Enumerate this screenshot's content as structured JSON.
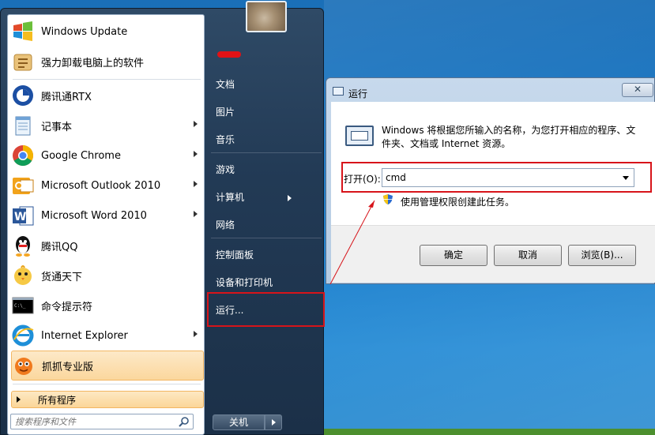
{
  "start_menu": {
    "programs": [
      {
        "label": "Windows Update",
        "icon": "windows-update-icon",
        "has_submenu": false
      },
      {
        "label": "强力卸载电脑上的软件",
        "icon": "uninstall-icon",
        "has_submenu": false
      },
      {
        "label": "腾讯通RTX",
        "icon": "rtx-icon",
        "has_submenu": false
      },
      {
        "label": "记事本",
        "icon": "notepad-icon",
        "has_submenu": true
      },
      {
        "label": "Google Chrome",
        "icon": "chrome-icon",
        "has_submenu": true
      },
      {
        "label": "Microsoft Outlook 2010",
        "icon": "outlook-icon",
        "has_submenu": true
      },
      {
        "label": "Microsoft Word 2010",
        "icon": "word-icon",
        "has_submenu": true
      },
      {
        "label": "腾讯QQ",
        "icon": "qq-icon",
        "has_submenu": false
      },
      {
        "label": "货通天下",
        "icon": "chick-icon",
        "has_submenu": false
      },
      {
        "label": "命令提示符",
        "icon": "cmd-icon",
        "has_submenu": false
      },
      {
        "label": "Internet Explorer",
        "icon": "ie-icon",
        "has_submenu": true
      },
      {
        "label": "抓抓专业版",
        "icon": "zhuazhua-icon",
        "has_submenu": false
      }
    ],
    "all_programs": "所有程序",
    "search_placeholder": "搜索程序和文件",
    "right_items": [
      {
        "label": "文档"
      },
      {
        "label": "图片"
      },
      {
        "label": "音乐"
      },
      {
        "label": "游戏"
      },
      {
        "label": "计算机",
        "has_submenu": true
      },
      {
        "label": "网络"
      },
      {
        "label": "控制面板"
      },
      {
        "label": "设备和打印机"
      },
      {
        "label": "运行..."
      }
    ],
    "shutdown": "关机"
  },
  "run_dialog": {
    "title": "运行",
    "close": "✕",
    "description": "Windows 将根据您所输入的名称，为您打开相应的程序、文件夹、文档或 Internet 资源。",
    "open_label": "打开(O):",
    "open_value": "cmd",
    "admin_note": "使用管理权限创建此任务。",
    "ok": "确定",
    "cancel": "取消",
    "browse": "浏览(B)..."
  },
  "colors": {
    "highlight_red": "#d7141a",
    "menu_hover": "#fbd79d"
  }
}
